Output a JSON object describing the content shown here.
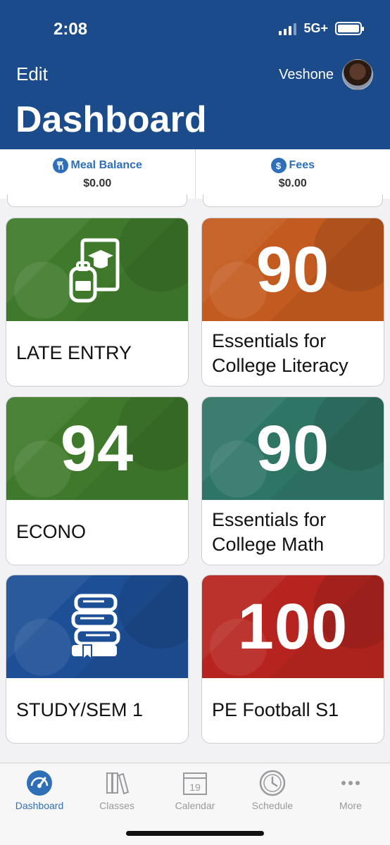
{
  "status_bar": {
    "time": "2:08",
    "network": "5G+"
  },
  "header": {
    "edit_label": "Edit",
    "user_name": "Veshone",
    "title": "Dashboard"
  },
  "balances": [
    {
      "label": "Meal Balance",
      "value": "$0.00",
      "icon": "utensils-icon"
    },
    {
      "label": "Fees",
      "value": "$0.00",
      "icon": "dollar-icon"
    }
  ],
  "cards": [
    {
      "grade": "",
      "name": "LATE ENTRY",
      "color": "#3f7a2c",
      "icon": "backpack-book-icon"
    },
    {
      "grade": "90",
      "name": "Essentials for College Literacy",
      "color": "#c35a1f"
    },
    {
      "grade": "94",
      "name": "ECONO",
      "color": "#3f7a2c"
    },
    {
      "grade": "90",
      "name": "Essentials for College Math",
      "color": "#2f7566"
    },
    {
      "grade": "",
      "name": "STUDY/SEM 1",
      "color": "#1d4f96",
      "icon": "book-stack-icon"
    },
    {
      "grade": "100",
      "name": "PE Football S1",
      "color": "#b7241f"
    }
  ],
  "tabbar": [
    {
      "label": "Dashboard",
      "icon": "speedometer-icon",
      "active": true
    },
    {
      "label": "Classes",
      "icon": "books-icon",
      "active": false
    },
    {
      "label": "Calendar",
      "icon": "calendar-icon",
      "active": false,
      "day": "19"
    },
    {
      "label": "Schedule",
      "icon": "clock-icon",
      "active": false
    },
    {
      "label": "More",
      "icon": "more-icon",
      "active": false
    }
  ]
}
